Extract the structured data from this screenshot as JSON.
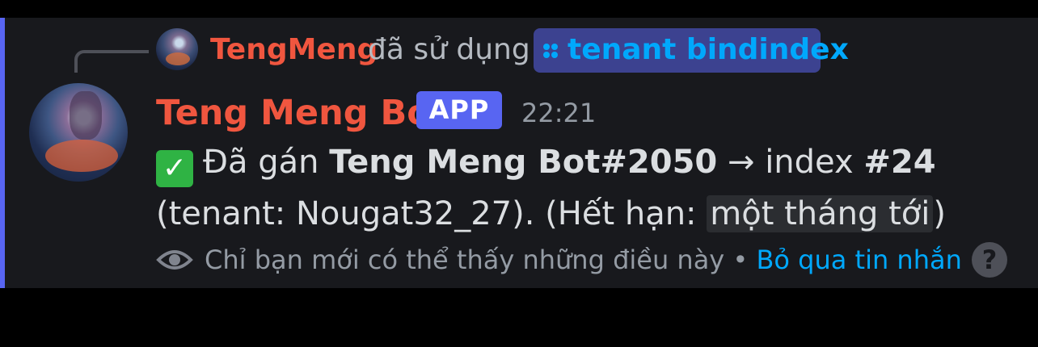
{
  "reply": {
    "username": "TengMeng",
    "verb": "đã sử dụng",
    "command": "tenant bindindex"
  },
  "message": {
    "author": "Teng Meng Bot",
    "tag": "APP",
    "timestamp": "22:21",
    "line1": {
      "prefix": "Đã gán ",
      "bot": "Teng Meng Bot#2050",
      "arrow": " → index ",
      "index": "#24"
    },
    "line2": {
      "text": "(tenant: Nougat32_27). (Hết hạn: ",
      "expiry": "một tháng tới",
      "close": ")"
    }
  },
  "footer": {
    "notice": "Chỉ bạn mới có thể thấy những điều này",
    "separator": " • ",
    "dismiss": "Bỏ qua tin nhắn"
  },
  "colors": {
    "username": "#f0563f",
    "accent": "#5865f2",
    "link": "#00a8fc",
    "background": "#18191d"
  },
  "icons": {
    "command": "command-icon",
    "check": "white-check-mark-icon",
    "eye": "eye-icon",
    "help": "help-icon"
  }
}
